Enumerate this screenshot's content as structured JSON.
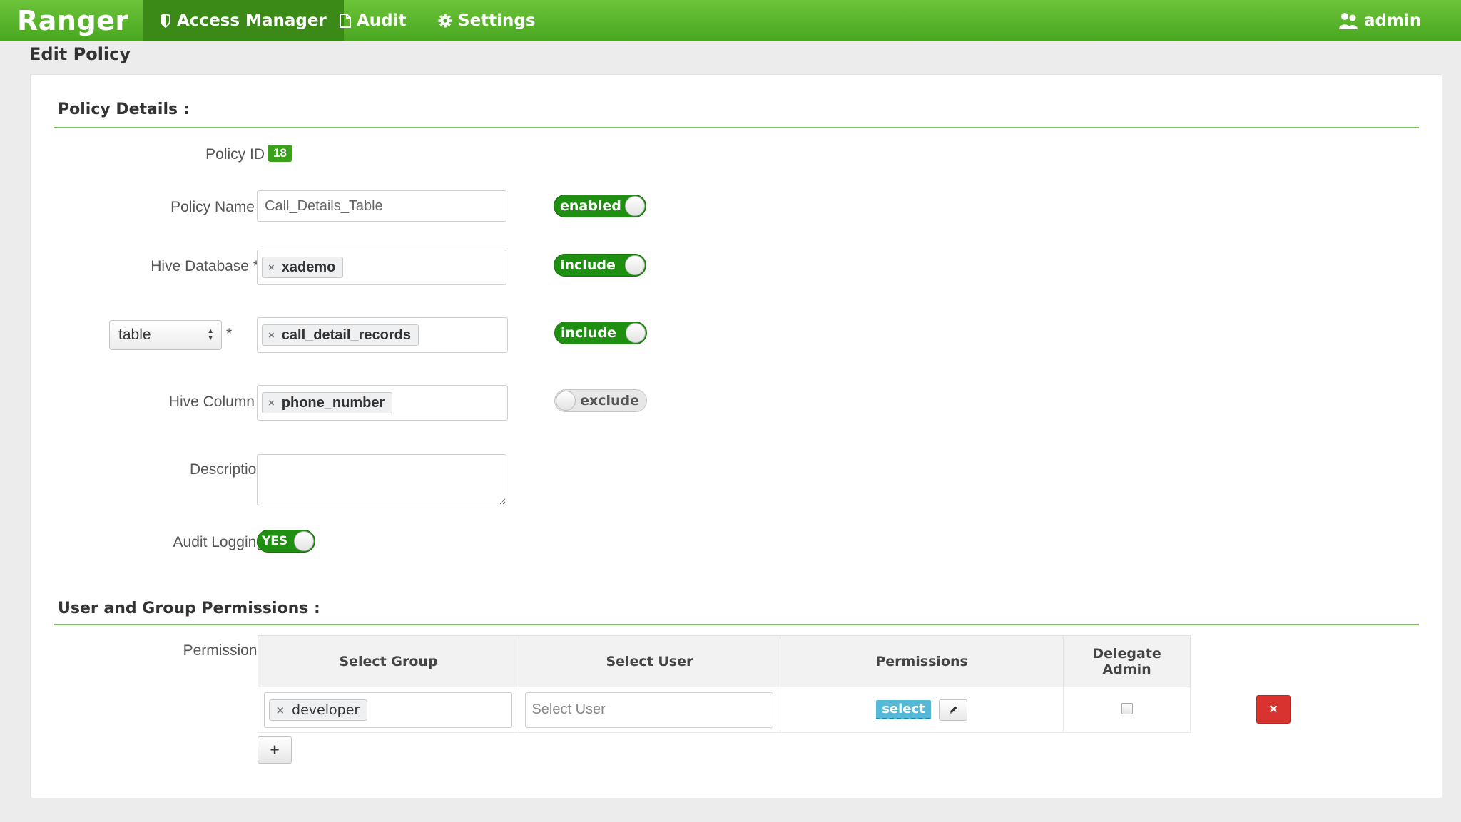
{
  "navbar": {
    "brand": "Ranger",
    "items": [
      {
        "label": "Access Manager",
        "icon": "shield-icon",
        "active": true
      },
      {
        "label": "Audit",
        "icon": "file-icon",
        "active": false
      },
      {
        "label": "Settings",
        "icon": "gear-icon",
        "active": false
      }
    ],
    "user": {
      "label": "admin",
      "icon": "user-icon"
    }
  },
  "page": {
    "title": "Edit Policy"
  },
  "policy_details": {
    "section_title": "Policy Details :",
    "policy_id": {
      "label": "Policy ID",
      "value": "18"
    },
    "policy_name": {
      "label": "Policy Name *",
      "value": "Call_Details_Table",
      "toggle": "enabled"
    },
    "hive_database": {
      "label": "Hive Database *",
      "tag": "xademo",
      "toggle": "include"
    },
    "table": {
      "select_value": "table",
      "asterisk": "*",
      "tag": "call_detail_records",
      "toggle": "include"
    },
    "hive_column": {
      "label": "Hive Column *",
      "tag": "phone_number",
      "toggle": "exclude"
    },
    "description": {
      "label": "Description",
      "value": ""
    },
    "audit_logging": {
      "label": "Audit Logging",
      "toggle": "YES"
    }
  },
  "permissions_section": {
    "section_title": "User and Group Permissions :",
    "label": "Permissions",
    "columns": [
      "Select Group",
      "Select User",
      "Permissions",
      "Delegate Admin"
    ],
    "delegate_admin_line1": "Delegate",
    "delegate_admin_line2": "Admin",
    "rows": [
      {
        "group_tag": "developer",
        "user_placeholder": "Select User",
        "permission": "select",
        "delegate_admin": false
      }
    ],
    "add_label": "+",
    "delete_label": "×"
  },
  "colors": {
    "navbar_green": "#4aa621",
    "active_tab": "#3b8a17",
    "toggle_on": "#1e8f10",
    "badge_green": "#3aa21a",
    "rule_green": "#79c152",
    "delete_red": "#d9332f",
    "permission_tag": "#55b8d6"
  }
}
